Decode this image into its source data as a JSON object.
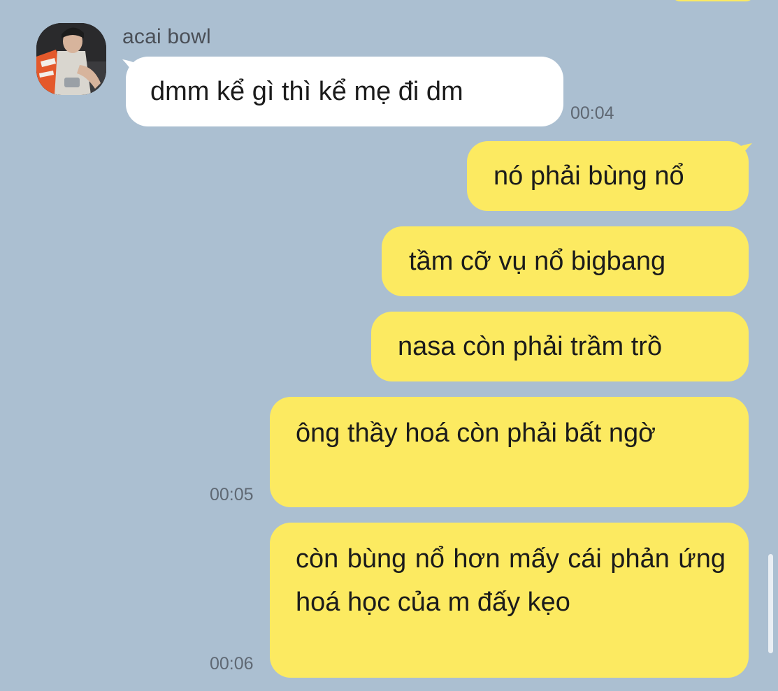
{
  "chat": {
    "sender_name": "acai bowl",
    "avatar_icon": "user-avatar-photo",
    "colors": {
      "background": "#abbfd1",
      "incoming_bubble": "#ffffff",
      "outgoing_bubble": "#fcea61",
      "timestamp": "#5f6873"
    },
    "messages": [
      {
        "direction": "incoming",
        "text": "dmm kể gì thì kể mẹ đi dm",
        "time": "00:04"
      },
      {
        "direction": "outgoing",
        "text": "nó phải bùng nổ",
        "time": ""
      },
      {
        "direction": "outgoing",
        "text": "tầm cỡ vụ nổ bigbang",
        "time": ""
      },
      {
        "direction": "outgoing",
        "text": "nasa còn phải trầm trồ",
        "time": ""
      },
      {
        "direction": "outgoing",
        "text": "ông thầy hoá còn phải bất ngờ",
        "time": "00:05"
      },
      {
        "direction": "outgoing",
        "text": "còn bùng nổ hơn mấy cái phản ứng hoá học của m đấy kẹo",
        "time": "00:06"
      }
    ]
  }
}
